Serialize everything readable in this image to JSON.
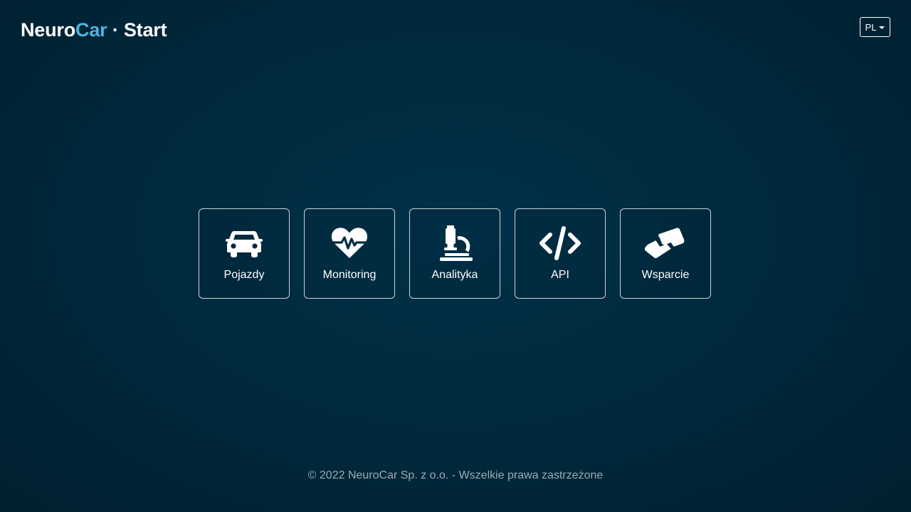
{
  "header": {
    "brand_primary": "Neuro",
    "brand_accent": "Car",
    "brand_suffix": " · Start",
    "accent_color": "#4fb3e0"
  },
  "language": {
    "selected": "PL"
  },
  "tiles": [
    {
      "label": "Pojazdy",
      "icon": "car-icon"
    },
    {
      "label": "Monitoring",
      "icon": "heart-pulse-icon"
    },
    {
      "label": "Analityka",
      "icon": "microscope-icon"
    },
    {
      "label": "API",
      "icon": "code-icon"
    },
    {
      "label": "Wsparcie",
      "icon": "handshake-icon"
    }
  ],
  "footer": {
    "text": "© 2022 NeuroCar Sp. z o.o. - Wszelkie prawa zastrzeżone"
  }
}
